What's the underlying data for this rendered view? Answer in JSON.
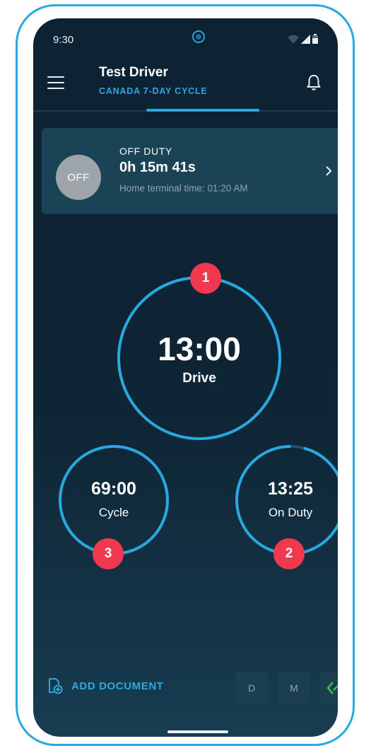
{
  "status_bar": {
    "time": "9:30"
  },
  "header": {
    "title": "Test Driver",
    "subtitle": "CANADA 7-DAY CYCLE"
  },
  "duty_card": {
    "badge": "OFF",
    "status": "OFF DUTY",
    "duration": "0h 15m 41s",
    "home_terminal": "Home terminal time: 01:20 AM"
  },
  "clocks": {
    "drive": {
      "value": "13:00",
      "label": "Drive",
      "marker": "1",
      "progress": 1.0
    },
    "cycle": {
      "value": "69:00",
      "label": "Cycle",
      "marker": "3",
      "progress": 1.0
    },
    "on_duty": {
      "value": "13:25",
      "label": "On Duty",
      "marker": "2",
      "progress": 0.96
    }
  },
  "bottom_bar": {
    "add_document": "ADD DOCUMENT",
    "btn_d": "D",
    "btn_m": "M"
  },
  "colors": {
    "accent": "#29a8e0",
    "marker": "#f0384f",
    "off_badge": "#9da5ab",
    "link_icon": "#39c24a"
  }
}
